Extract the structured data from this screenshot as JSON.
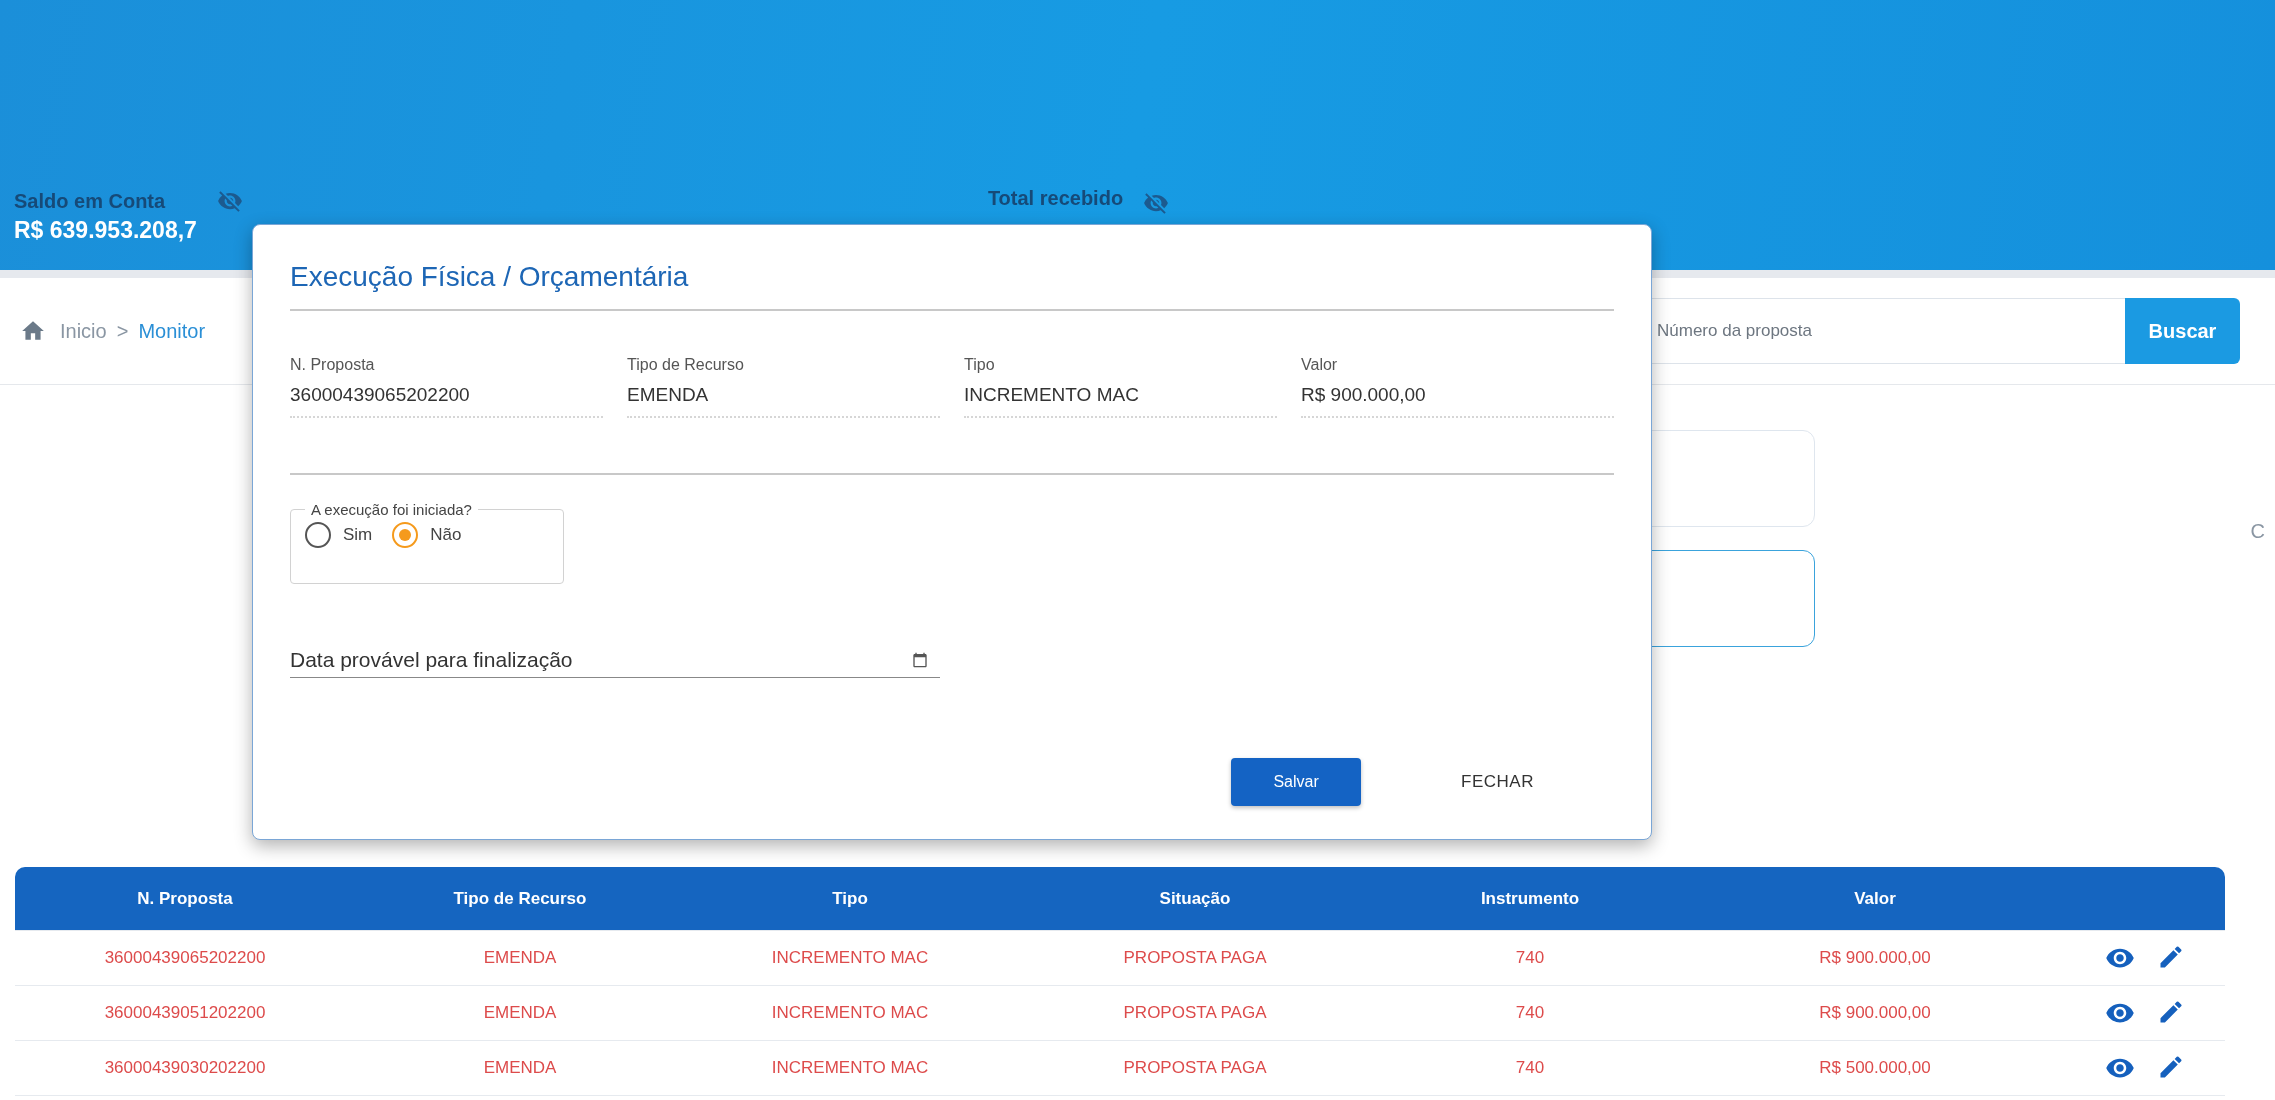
{
  "header": {
    "balance": {
      "label": "Saldo em Conta",
      "value": "R$ 639.953.208,7"
    },
    "received": {
      "label": "Total recebido"
    }
  },
  "breadcrumb": {
    "items": [
      {
        "label": "Inicio",
        "selected": false
      },
      {
        "label": "Monitor",
        "selected": true
      }
    ],
    "separator": ">"
  },
  "search": {
    "placeholder": "Número da proposta",
    "button": "Buscar"
  },
  "cards": [
    {
      "highlighted": false
    },
    {
      "highlighted": true
    }
  ],
  "side_label": "C",
  "table": {
    "columns": [
      "N. Proposta",
      "Tipo de Recurso",
      "Tipo",
      "Situação",
      "Instrumento",
      "Valor"
    ],
    "rows": [
      [
        "36000439065202200",
        "EMENDA",
        "INCREMENTO MAC",
        "PROPOSTA PAGA",
        "740",
        "R$ 900.000,00"
      ],
      [
        "36000439051202200",
        "EMENDA",
        "INCREMENTO MAC",
        "PROPOSTA PAGA",
        "740",
        "R$ 900.000,00"
      ],
      [
        "36000439030202200",
        "EMENDA",
        "INCREMENTO MAC",
        "PROPOSTA PAGA",
        "740",
        "R$ 500.000,00"
      ]
    ]
  },
  "dialog": {
    "title": "Execução Física / Orçamentária",
    "fields": [
      {
        "label": "N. Proposta",
        "value": "36000439065202200"
      },
      {
        "label": "Tipo de Recurso",
        "value": "EMENDA"
      },
      {
        "label": "Tipo",
        "value": "INCREMENTO MAC"
      },
      {
        "label": "Valor",
        "value": "R$ 900.000,00"
      }
    ],
    "question": {
      "legend": "A execução foi iniciada?",
      "options": [
        {
          "label": "Sim",
          "selected": false
        },
        {
          "label": "Não",
          "selected": true
        }
      ]
    },
    "date_field": {
      "placeholder": "Data provável para finalização"
    },
    "buttons": [
      {
        "label": "Salvar",
        "kind": "primary"
      },
      {
        "label": "FECHAR",
        "kind": "text"
      }
    ]
  }
}
